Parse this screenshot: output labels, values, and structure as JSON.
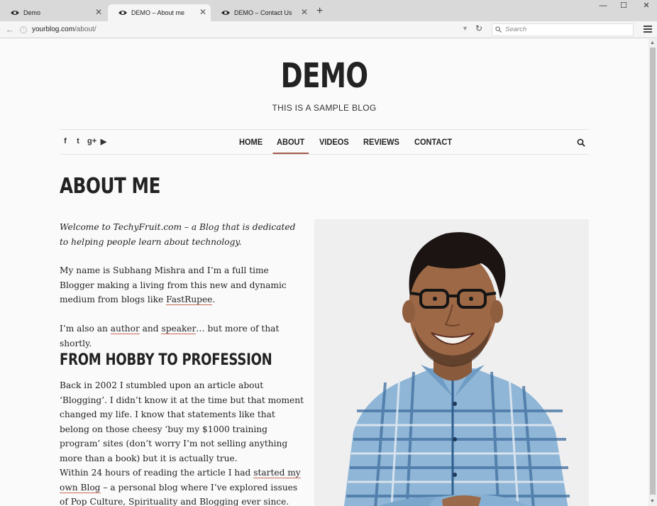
{
  "browser": {
    "tabs": [
      {
        "label": "Demo",
        "close": "✕"
      },
      {
        "label": "DEMO – About me",
        "close": "✕"
      },
      {
        "label": "DEMO – Contact Us",
        "close": "✕"
      }
    ],
    "new_tab": "+",
    "window": {
      "minimize": "—",
      "maximize": "☐",
      "close": "✕"
    },
    "url_host": "yourblog.com",
    "url_path": "/about/",
    "search_placeholder": "Search"
  },
  "site": {
    "title": "DEMO",
    "tagline": "THIS IS A SAMPLE BLOG"
  },
  "social": [
    "f",
    "t",
    "g+",
    "▶"
  ],
  "nav": {
    "items": [
      "HOME",
      "ABOUT",
      "VIDEOS",
      "REVIEWS",
      "CONTACT"
    ],
    "active": "ABOUT"
  },
  "content": {
    "page_title": "ABOUT ME",
    "p1": "Welcome to TechyFruit.com – a Blog that is dedicated to helping people learn about technology.",
    "p2_before": "My name is Subhang Mishra and I’m a full time Blogger making a living from this new and dynamic medium from blogs like ",
    "p2_link": "FastRupee",
    "p2_after": ".",
    "p3_before": "I’m also an ",
    "p3_link1": "author",
    "p3_mid": " and ",
    "p3_link2": "speaker",
    "p3_after": "… but more of that shortly.",
    "h2": "FROM HOBBY TO PROFESSION",
    "p4": "Back in 2002 I stumbled upon an article about ‘Blogging’. I didn’t know it at the time but that moment changed my life. I know that statements like that belong on those cheesy ‘buy my $1000 training program’ sites (don’t worry I’m not selling anything more than a book) but it is actually true.",
    "p5_before": "Within 24 hours of reading the article I had ",
    "p5_link": "started my own Blog",
    "p5_after": " – a personal blog where I’ve explored issues of Pop Culture, Spirituality and Blogging ever since. I’ve learned so"
  },
  "colors": {
    "accent": "#a25b4c",
    "link_underline": "#c86a56",
    "text": "#222222",
    "background": "#fafafa"
  }
}
